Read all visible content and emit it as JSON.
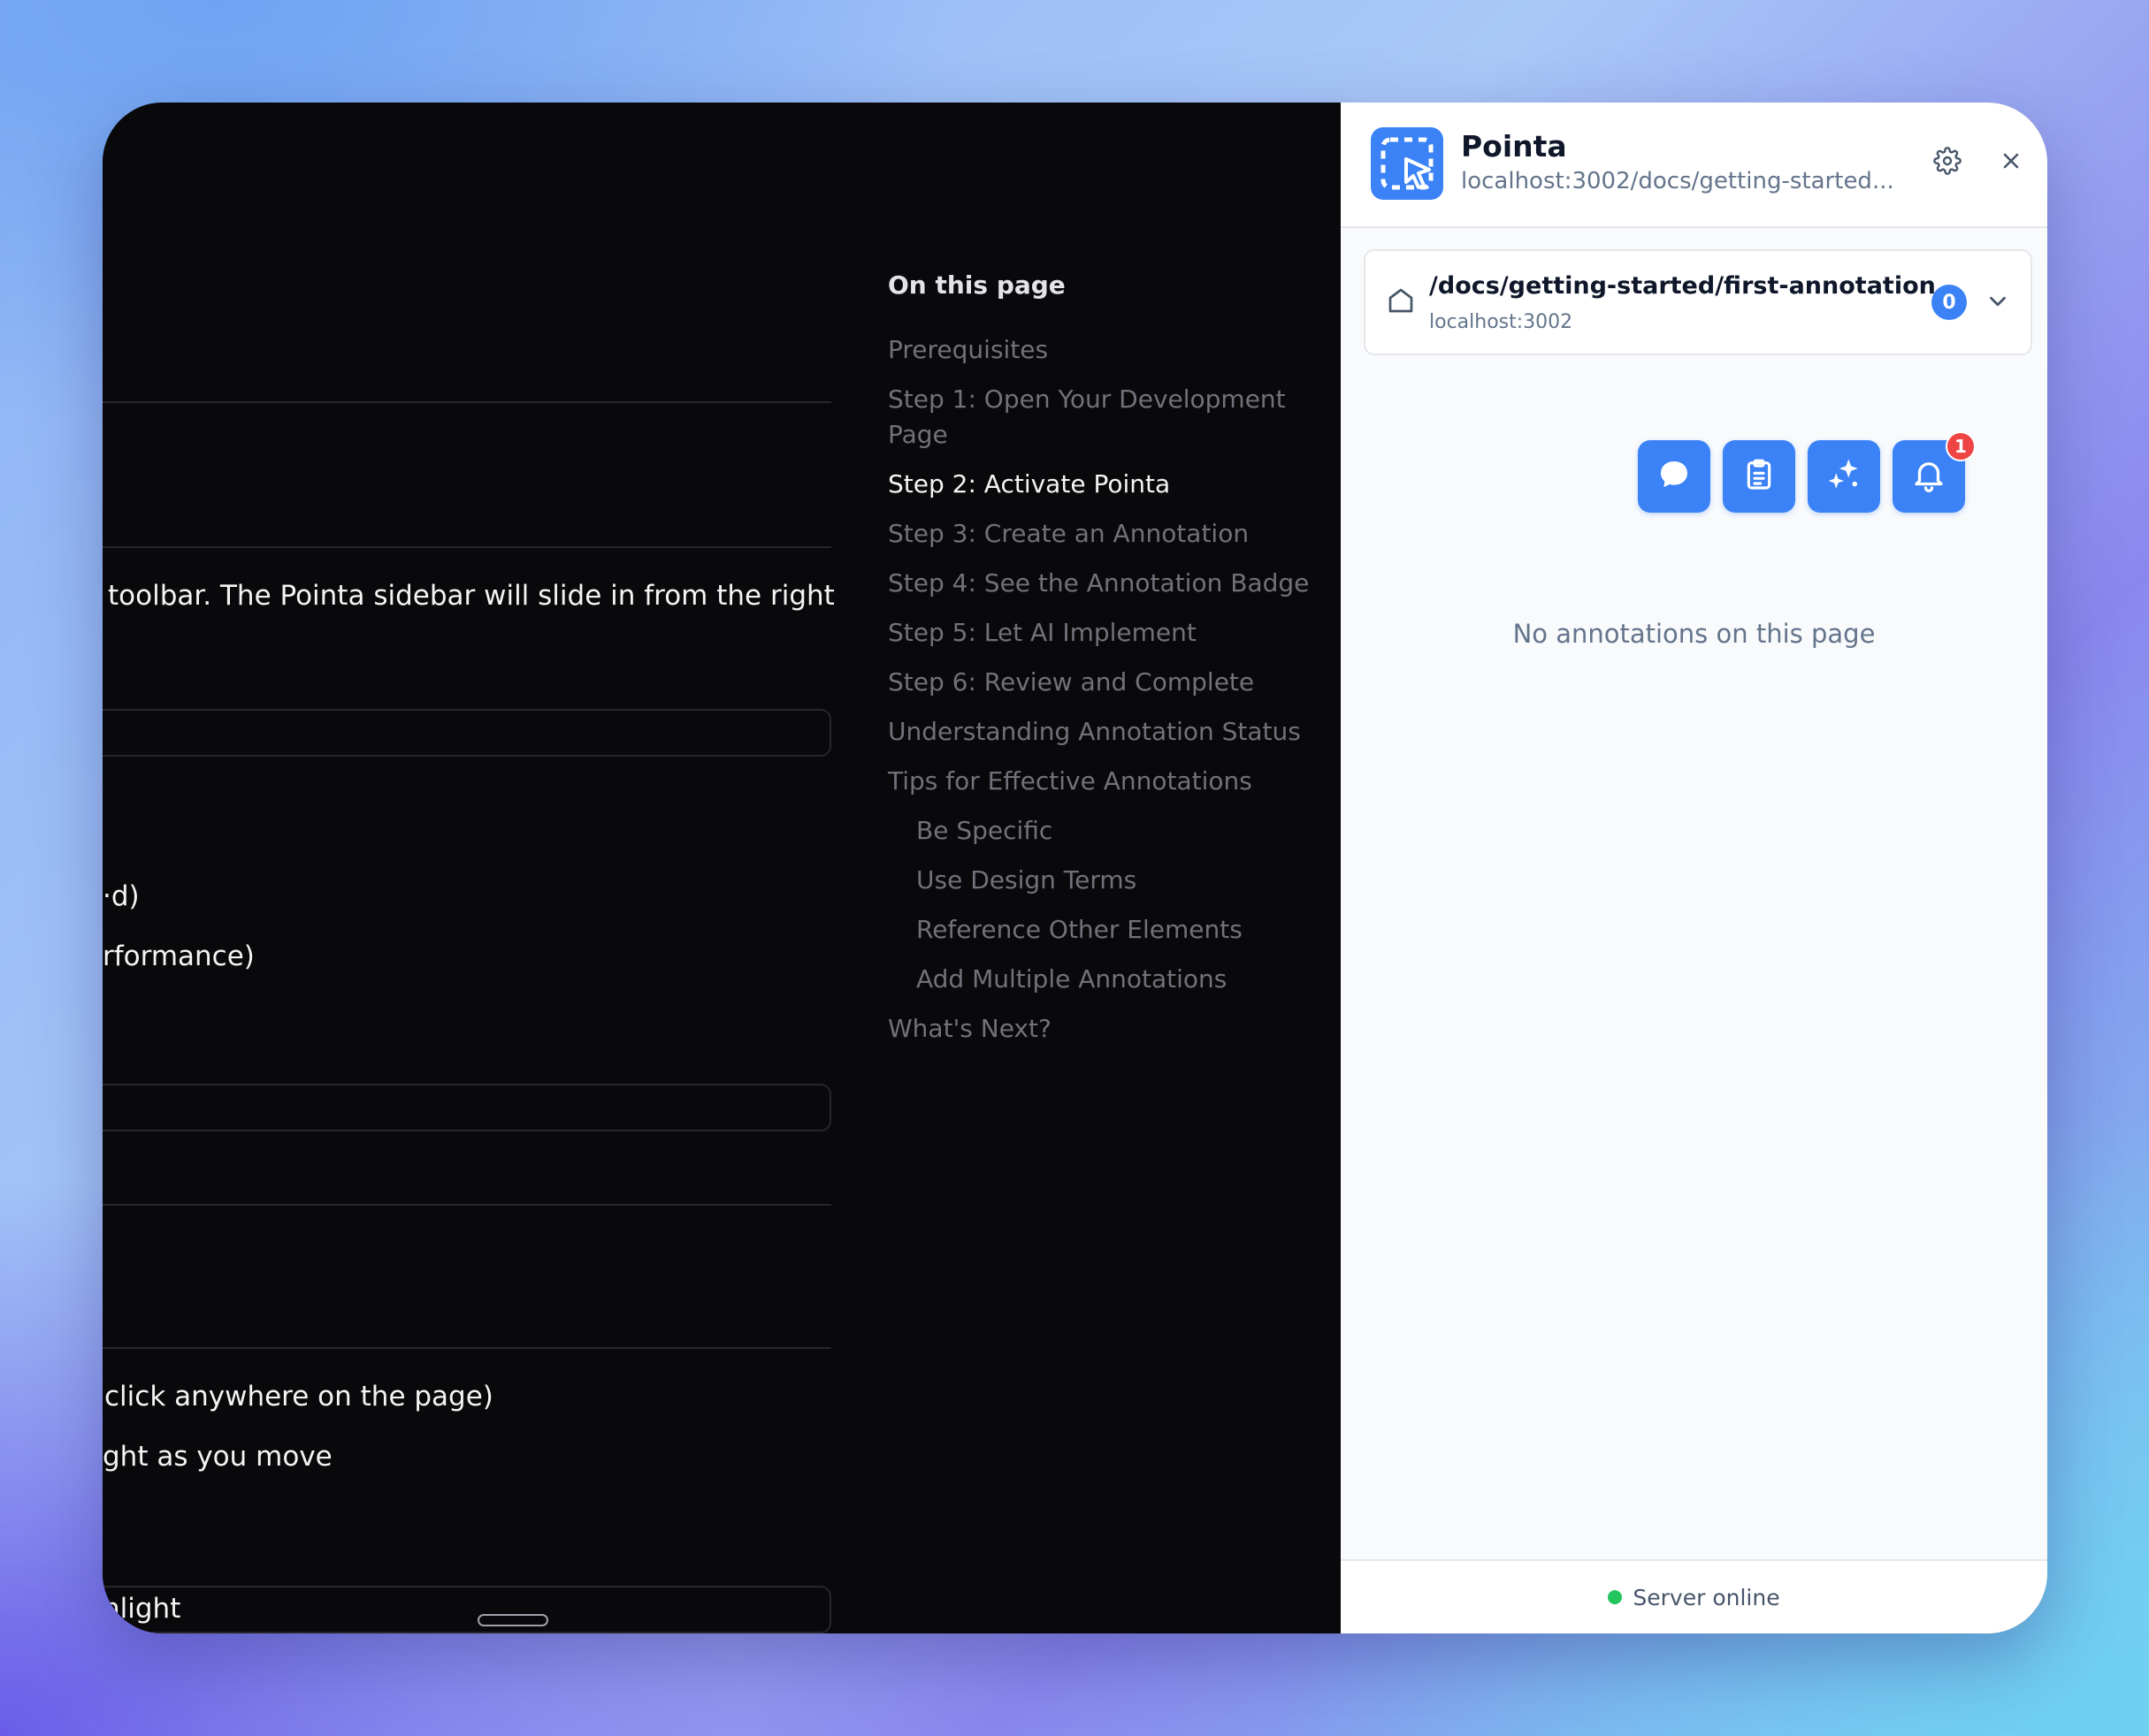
{
  "doc": {
    "lines": [
      "toolbar. The Pointa sidebar will slide in from the right",
      "·d)",
      "rformance)",
      "click anywhere on the page)",
      "ght as you move",
      "hlight"
    ]
  },
  "toc": {
    "title": "On this page",
    "items": [
      "Prerequisites",
      "Step 1: Open Your Development",
      "Page",
      "Step 2: Activate Pointa",
      "Step 3: Create an Annotation",
      "Step 4: See the Annotation Badge",
      "Step 5: Let AI Implement",
      "Step 6: Review and Complete",
      "Understanding Annotation Status",
      "Tips for Effective Annotations",
      "Be Specific",
      "Use Design Terms",
      "Reference Other Elements",
      "Add Multiple Annotations",
      "What's Next?"
    ]
  },
  "panel": {
    "title": "Pointa",
    "url": "localhost:3002/docs/getting-started...",
    "page_path": "/docs/getting-started/first-annotation",
    "page_host": "localhost:3002",
    "annotation_count": "0",
    "notification_count": "1",
    "empty_message": "No annotations on this page",
    "status": "Server online"
  },
  "colors": {
    "accent": "#3b82f6",
    "status_online": "#22c55e",
    "notification": "#ef4444"
  }
}
